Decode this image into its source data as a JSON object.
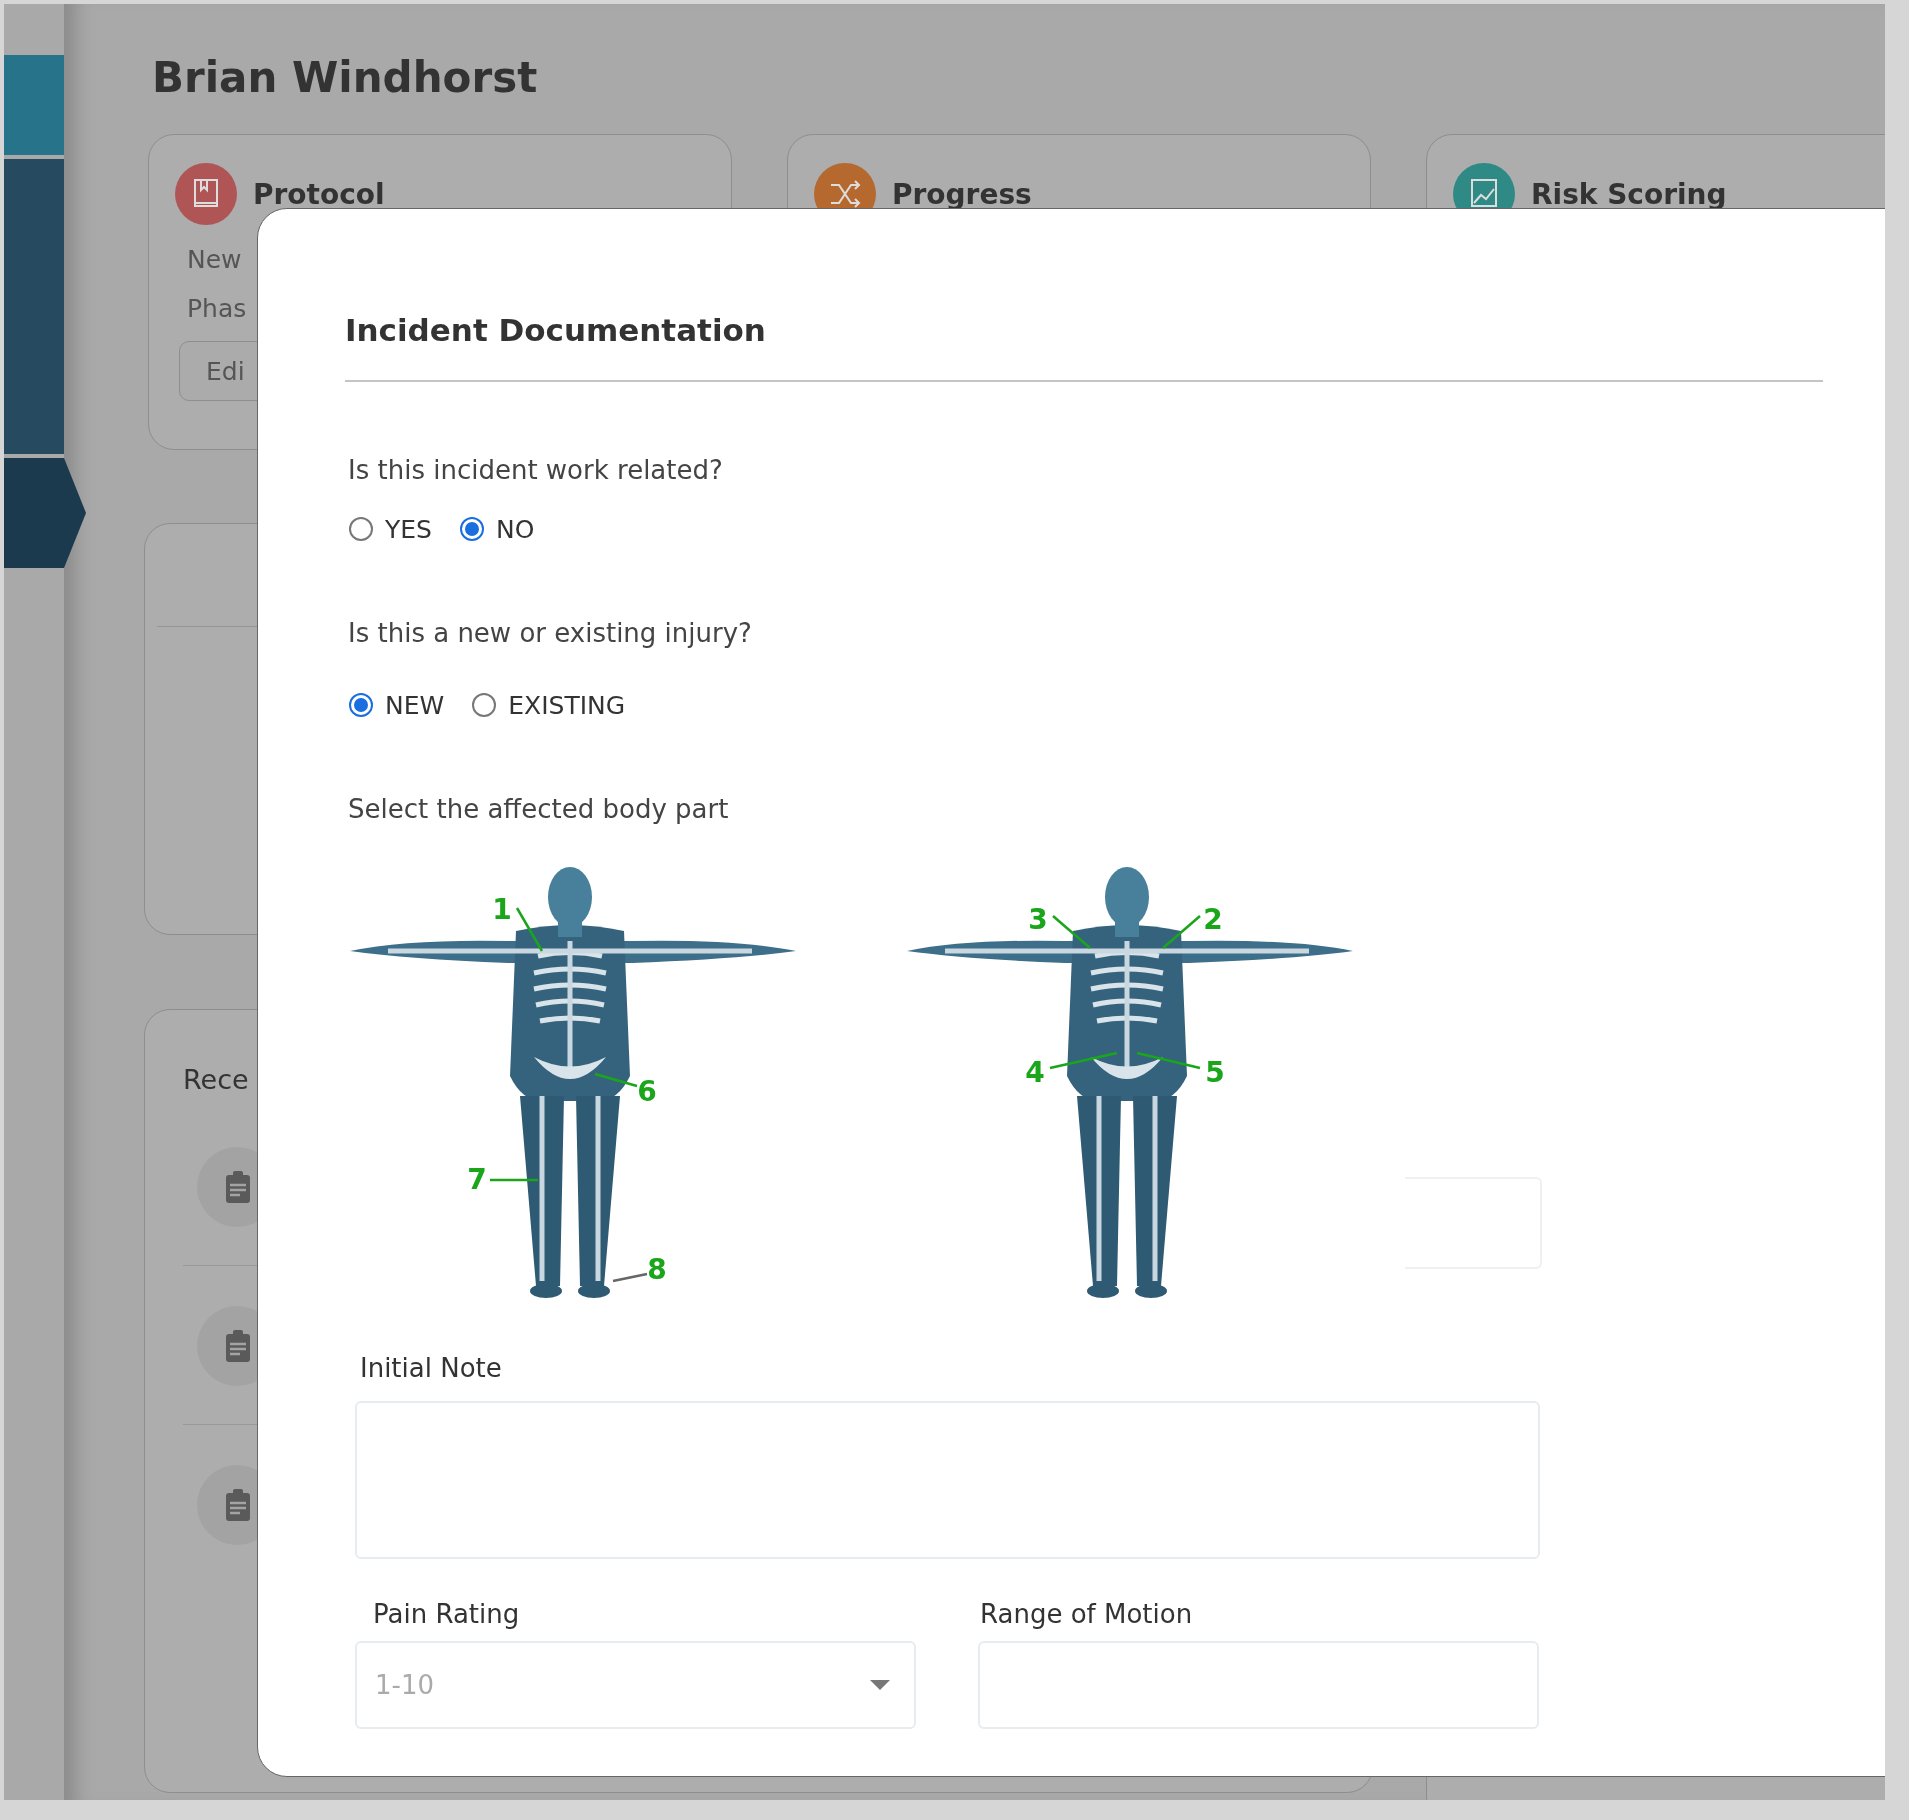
{
  "sidebar": {
    "items": [
      {
        "color": "#27748a",
        "selected": false
      },
      {
        "color": "#264a60",
        "selected": false
      },
      {
        "color": "#1c3a4d",
        "selected": true
      }
    ]
  },
  "page": {
    "title": "Brian Windhorst",
    "cards": [
      {
        "title": "Protocol",
        "color": "#b05555",
        "lines": [
          "New",
          "Phas"
        ],
        "button": "Edi"
      },
      {
        "title": "Progress",
        "color": "#b5692f"
      },
      {
        "title": "Risk Scoring",
        "color": "#2f8a85"
      }
    ],
    "recent": {
      "title": "Rece"
    }
  },
  "modal": {
    "title": "Incident Documentation",
    "questions": [
      {
        "label": "Is this incident work related?",
        "options": [
          {
            "label": "YES",
            "selected": false
          },
          {
            "label": "NO",
            "selected": true
          }
        ]
      },
      {
        "label": "Is this a new or existing injury?",
        "options": [
          {
            "label": "NEW",
            "selected": true
          },
          {
            "label": "EXISTING",
            "selected": false
          }
        ]
      }
    ],
    "body_part": {
      "label": "Select the affected body part",
      "figures": [
        {
          "markers": [
            {
              "label": "1"
            },
            {
              "label": "6"
            },
            {
              "label": "7"
            },
            {
              "label": "8"
            }
          ]
        },
        {
          "markers": [
            {
              "label": "3"
            },
            {
              "label": "2"
            },
            {
              "label": "4"
            },
            {
              "label": "5"
            }
          ]
        }
      ]
    },
    "initial_note": {
      "label": "Initial Note"
    },
    "pain_rating": {
      "label": "Pain Rating",
      "placeholder": "1-10"
    },
    "range_of_motion": {
      "label": "Range of Motion"
    }
  }
}
